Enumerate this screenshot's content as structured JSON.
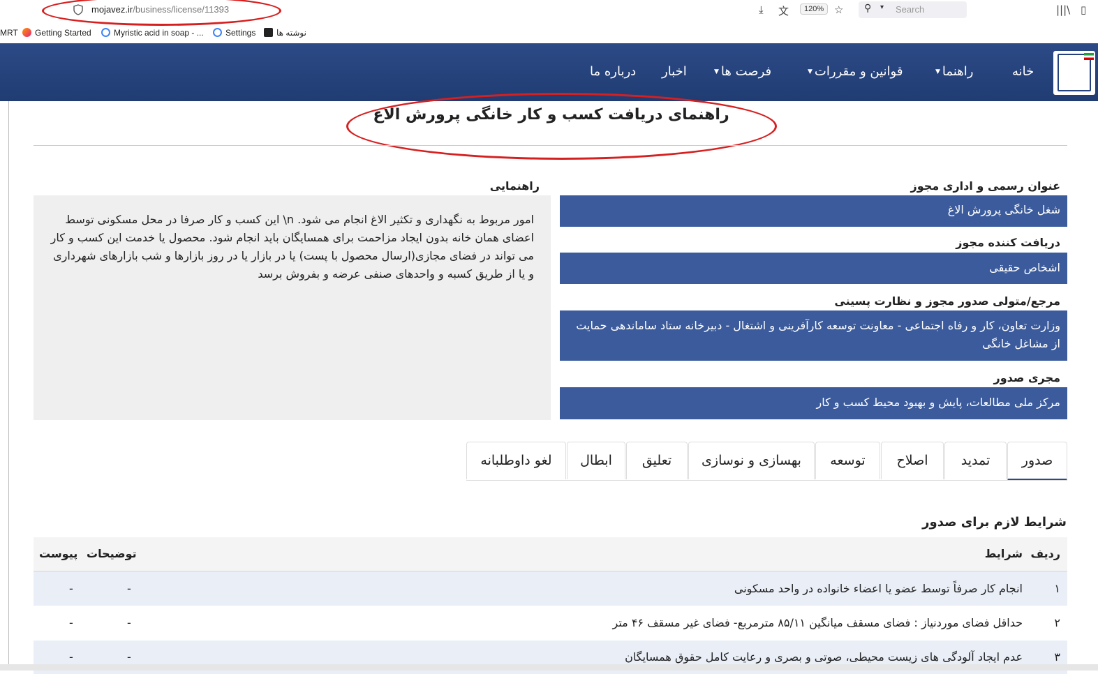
{
  "browser": {
    "url_domain": "mojavez.ir",
    "url_path": "/business/license/11393",
    "zoom": "120%",
    "search_placeholder": "Search",
    "bookmarks": [
      {
        "label": "MRT"
      },
      {
        "label": "Getting Started"
      },
      {
        "label": "Myristic acid in soap - ..."
      },
      {
        "label": "Settings"
      },
      {
        "label": "نوشته ها"
      }
    ]
  },
  "nav": {
    "home": "خانه",
    "guides": "راهنما",
    "laws": "قوانین و مقررات",
    "opportunities": "فرصت ها",
    "news": "اخبار",
    "about": "درباره ما"
  },
  "page": {
    "title": "راهنمای دریافت کسب و کار خانگی پرورش الاغ"
  },
  "info": {
    "official_title_label": "عنوان رسمی و اداری مجوز",
    "official_title_value": "شغل خانگی پرورش الاغ",
    "recipient_label": "دریافت کننده مجوز",
    "recipient_value": "اشخاص حقیقی",
    "authority_label": "مرجع/متولی صدور مجوز و نظارت پسینی",
    "authority_value": "وزارت تعاون، کار و رفاه اجتماعی - معاونت توسعه کارآفرینی و اشتغال - دبیرخانه ستاد ساماندهی حمایت از مشاغل خانگی",
    "executor_label": "مجری صدور",
    "executor_value": "مرکز ملی مطالعات، پایش و بهبود محیط کسب و کار",
    "guide_label": "راهنمایی",
    "guide_text": "امور مربوط به نگهداری و تکثیر الاغ انجام می شود. n\\ این کسب و کار صرفا در محل مسکونی توسط اعضای همان خانه بدون ایجاد مزاحمت برای همسایگان باید انجام شود. محصول یا خدمت این کسب و کار می تواند در فضای مجازی(ارسال محصول با پست) یا در بازار یا در روز بازارها و شب بازارهای شهرداری و یا از طریق کسبه و واحدهای صنفی عرضه و بفروش برسد"
  },
  "tabs": [
    {
      "label": "صدور",
      "active": true
    },
    {
      "label": "تمدید",
      "active": false
    },
    {
      "label": "اصلاح",
      "active": false
    },
    {
      "label": "توسعه",
      "active": false
    },
    {
      "label": "بهسازی و نوسازی",
      "active": false
    },
    {
      "label": "تعلیق",
      "active": false
    },
    {
      "label": "ابطال",
      "active": false
    },
    {
      "label": "لغو داوطلبانه",
      "active": false
    }
  ],
  "conditions": {
    "title": "شرایط لازم برای صدور",
    "headers": {
      "row": "ردیف",
      "condition": "شرایط",
      "description": "توضیحات",
      "attachment": "پیوست"
    },
    "rows": [
      {
        "num": "۱",
        "condition": "انجام کار صرفاً توسط عضو یا اعضاء خانواده در واحد مسکونی",
        "description": "-",
        "attachment": "-"
      },
      {
        "num": "۲",
        "condition": "حداقل فضای موردنیاز :  فضای مسقف میانگین ۸۵/۱۱ مترمربع- فضای غیر مسقف ۴۶ متر",
        "description": "-",
        "attachment": "-"
      },
      {
        "num": "۳",
        "condition": "عدم ایجاد آلودگی های زیست محیطی، صوتی و بصری و رعایت کامل حقوق همسایگان",
        "description": "-",
        "attachment": "-"
      }
    ]
  },
  "colors": {
    "nav_bg": "#2c4a86",
    "info_box": "#3b5b9c",
    "annotation_red": "#d62020",
    "striped_row": "#e9eef7"
  }
}
